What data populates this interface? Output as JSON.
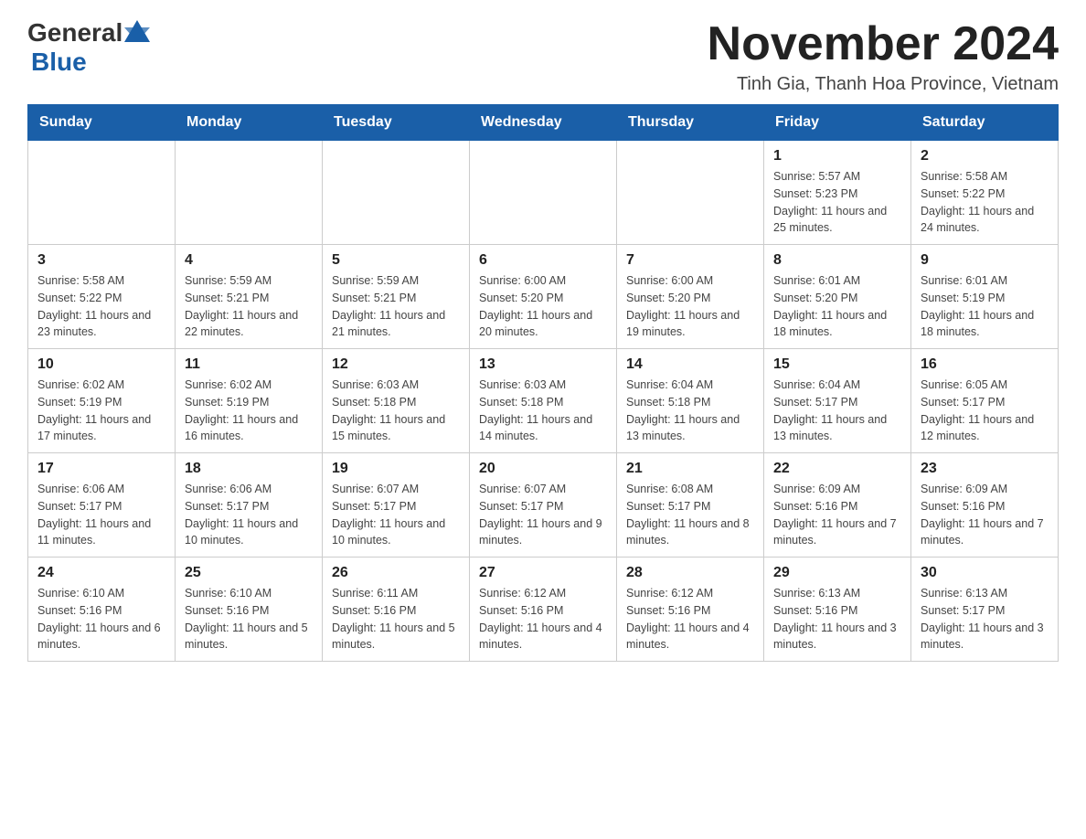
{
  "logo": {
    "general": "General",
    "blue": "Blue"
  },
  "header": {
    "month_title": "November 2024",
    "location": "Tinh Gia, Thanh Hoa Province, Vietnam"
  },
  "weekdays": [
    "Sunday",
    "Monday",
    "Tuesday",
    "Wednesday",
    "Thursday",
    "Friday",
    "Saturday"
  ],
  "weeks": [
    [
      {
        "day": "",
        "info": ""
      },
      {
        "day": "",
        "info": ""
      },
      {
        "day": "",
        "info": ""
      },
      {
        "day": "",
        "info": ""
      },
      {
        "day": "",
        "info": ""
      },
      {
        "day": "1",
        "info": "Sunrise: 5:57 AM\nSunset: 5:23 PM\nDaylight: 11 hours and 25 minutes."
      },
      {
        "day": "2",
        "info": "Sunrise: 5:58 AM\nSunset: 5:22 PM\nDaylight: 11 hours and 24 minutes."
      }
    ],
    [
      {
        "day": "3",
        "info": "Sunrise: 5:58 AM\nSunset: 5:22 PM\nDaylight: 11 hours and 23 minutes."
      },
      {
        "day": "4",
        "info": "Sunrise: 5:59 AM\nSunset: 5:21 PM\nDaylight: 11 hours and 22 minutes."
      },
      {
        "day": "5",
        "info": "Sunrise: 5:59 AM\nSunset: 5:21 PM\nDaylight: 11 hours and 21 minutes."
      },
      {
        "day": "6",
        "info": "Sunrise: 6:00 AM\nSunset: 5:20 PM\nDaylight: 11 hours and 20 minutes."
      },
      {
        "day": "7",
        "info": "Sunrise: 6:00 AM\nSunset: 5:20 PM\nDaylight: 11 hours and 19 minutes."
      },
      {
        "day": "8",
        "info": "Sunrise: 6:01 AM\nSunset: 5:20 PM\nDaylight: 11 hours and 18 minutes."
      },
      {
        "day": "9",
        "info": "Sunrise: 6:01 AM\nSunset: 5:19 PM\nDaylight: 11 hours and 18 minutes."
      }
    ],
    [
      {
        "day": "10",
        "info": "Sunrise: 6:02 AM\nSunset: 5:19 PM\nDaylight: 11 hours and 17 minutes."
      },
      {
        "day": "11",
        "info": "Sunrise: 6:02 AM\nSunset: 5:19 PM\nDaylight: 11 hours and 16 minutes."
      },
      {
        "day": "12",
        "info": "Sunrise: 6:03 AM\nSunset: 5:18 PM\nDaylight: 11 hours and 15 minutes."
      },
      {
        "day": "13",
        "info": "Sunrise: 6:03 AM\nSunset: 5:18 PM\nDaylight: 11 hours and 14 minutes."
      },
      {
        "day": "14",
        "info": "Sunrise: 6:04 AM\nSunset: 5:18 PM\nDaylight: 11 hours and 13 minutes."
      },
      {
        "day": "15",
        "info": "Sunrise: 6:04 AM\nSunset: 5:17 PM\nDaylight: 11 hours and 13 minutes."
      },
      {
        "day": "16",
        "info": "Sunrise: 6:05 AM\nSunset: 5:17 PM\nDaylight: 11 hours and 12 minutes."
      }
    ],
    [
      {
        "day": "17",
        "info": "Sunrise: 6:06 AM\nSunset: 5:17 PM\nDaylight: 11 hours and 11 minutes."
      },
      {
        "day": "18",
        "info": "Sunrise: 6:06 AM\nSunset: 5:17 PM\nDaylight: 11 hours and 10 minutes."
      },
      {
        "day": "19",
        "info": "Sunrise: 6:07 AM\nSunset: 5:17 PM\nDaylight: 11 hours and 10 minutes."
      },
      {
        "day": "20",
        "info": "Sunrise: 6:07 AM\nSunset: 5:17 PM\nDaylight: 11 hours and 9 minutes."
      },
      {
        "day": "21",
        "info": "Sunrise: 6:08 AM\nSunset: 5:17 PM\nDaylight: 11 hours and 8 minutes."
      },
      {
        "day": "22",
        "info": "Sunrise: 6:09 AM\nSunset: 5:16 PM\nDaylight: 11 hours and 7 minutes."
      },
      {
        "day": "23",
        "info": "Sunrise: 6:09 AM\nSunset: 5:16 PM\nDaylight: 11 hours and 7 minutes."
      }
    ],
    [
      {
        "day": "24",
        "info": "Sunrise: 6:10 AM\nSunset: 5:16 PM\nDaylight: 11 hours and 6 minutes."
      },
      {
        "day": "25",
        "info": "Sunrise: 6:10 AM\nSunset: 5:16 PM\nDaylight: 11 hours and 5 minutes."
      },
      {
        "day": "26",
        "info": "Sunrise: 6:11 AM\nSunset: 5:16 PM\nDaylight: 11 hours and 5 minutes."
      },
      {
        "day": "27",
        "info": "Sunrise: 6:12 AM\nSunset: 5:16 PM\nDaylight: 11 hours and 4 minutes."
      },
      {
        "day": "28",
        "info": "Sunrise: 6:12 AM\nSunset: 5:16 PM\nDaylight: 11 hours and 4 minutes."
      },
      {
        "day": "29",
        "info": "Sunrise: 6:13 AM\nSunset: 5:16 PM\nDaylight: 11 hours and 3 minutes."
      },
      {
        "day": "30",
        "info": "Sunrise: 6:13 AM\nSunset: 5:17 PM\nDaylight: 11 hours and 3 minutes."
      }
    ]
  ]
}
